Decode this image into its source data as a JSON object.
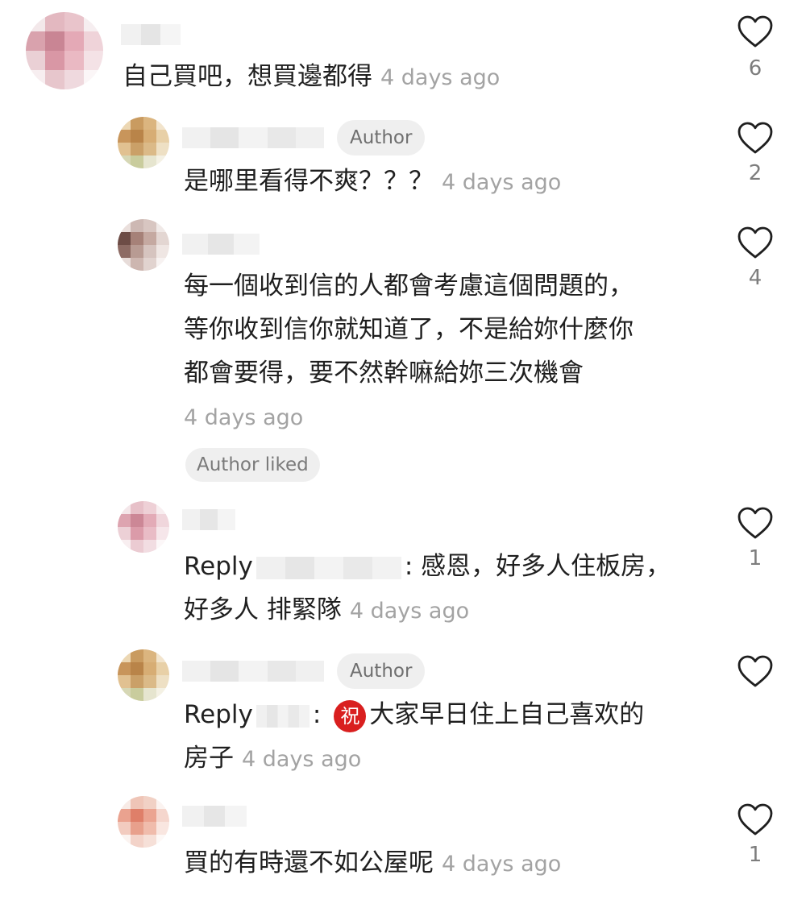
{
  "comments": [
    {
      "text": "自己買吧，想買邊都得",
      "time": "4 days ago",
      "likes": "6"
    },
    {
      "author_badge": "Author",
      "text": "是哪里看得不爽？？？",
      "time": "4 days ago",
      "likes": "2"
    },
    {
      "lines": [
        "每一個收到信的人都會考慮這個問題的，",
        "等你收到信你就知道了，不是給妳什麼你",
        "都會要得，要不然幹嘛給妳三次機會"
      ],
      "time": "4 days ago",
      "likes": "4",
      "author_liked": "Author liked"
    },
    {
      "reply_label": "Reply",
      "line1": ": 感恩，好多人住板房，",
      "line2": "好多人 排緊隊",
      "time": "4 days ago",
      "likes": "1"
    },
    {
      "author_badge": "Author",
      "reply_label": "Reply",
      "emoji": "祝",
      "line1": "大家早日住上自己喜欢的",
      "line2": "房子",
      "time": "4 days ago"
    },
    {
      "text": "買的有時還不如公屋呢",
      "time": "4 days ago",
      "likes": "1"
    }
  ],
  "icons": {
    "like": "heart-outline-icon"
  },
  "colors": {
    "meta": "#a3a3a3",
    "badge_bg": "#efefef",
    "emoji_bg": "#d91f1f"
  }
}
